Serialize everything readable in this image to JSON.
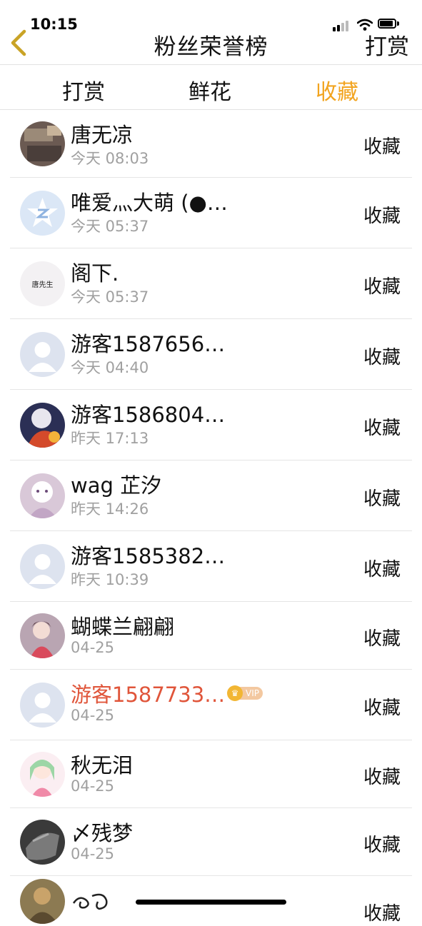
{
  "status_bar": {
    "time": "10:15"
  },
  "nav": {
    "title": "粉丝荣誉榜",
    "right_label": "打赏",
    "back_icon_color": "#c9a326"
  },
  "tabs": [
    {
      "label": "打赏",
      "active": false
    },
    {
      "label": "鲜花",
      "active": false
    },
    {
      "label": "收藏",
      "active": true
    }
  ],
  "accent_color": "#f2a41f",
  "fans": [
    {
      "name": "唐无凉",
      "time": "今天 08:03",
      "action": "收藏",
      "vip": false,
      "avatar": "photo"
    },
    {
      "name": "唯爱灬大萌 (●…",
      "time": "今天 05:37",
      "action": "收藏",
      "vip": false,
      "avatar": "qq-star"
    },
    {
      "name": "阁下.",
      "time": "今天 05:37",
      "action": "收藏",
      "vip": false,
      "avatar": "text",
      "avatar_text": "唐先生"
    },
    {
      "name": "游客1587656…",
      "time": "今天 04:40",
      "action": "收藏",
      "vip": false,
      "avatar": "default"
    },
    {
      "name": "游客1586804…",
      "time": "昨天 17:13",
      "action": "收藏",
      "vip": false,
      "avatar": "anime"
    },
    {
      "name": "wag 芷汐",
      "time": "昨天 14:26",
      "action": "收藏",
      "vip": false,
      "avatar": "anime-pink"
    },
    {
      "name": "游客1585382…",
      "time": "昨天 10:39",
      "action": "收藏",
      "vip": false,
      "avatar": "default"
    },
    {
      "name": "蝴蝶兰翩翩",
      "time": "04-25",
      "action": "收藏",
      "vip": false,
      "avatar": "anime-red"
    },
    {
      "name": "游客1587733…",
      "time": "04-25",
      "action": "收藏",
      "vip": true,
      "vip_label": "VIP",
      "avatar": "default"
    },
    {
      "name": "秋无泪",
      "time": "04-25",
      "action": "收藏",
      "vip": false,
      "avatar": "anime-green"
    },
    {
      "name": "〆残梦",
      "time": "04-25",
      "action": "收藏",
      "vip": false,
      "avatar": "dark"
    },
    {
      "name": "",
      "time": "",
      "action": "收藏",
      "vip": false,
      "avatar": "warrior"
    }
  ]
}
